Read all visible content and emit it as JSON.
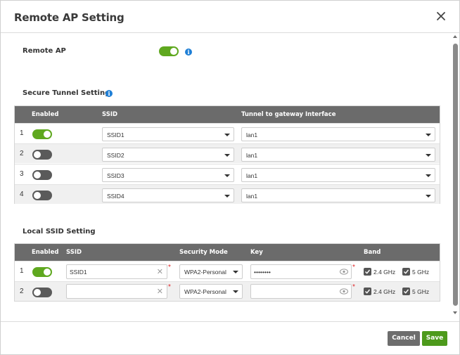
{
  "dialog": {
    "title": "Remote AP Setting"
  },
  "remote_ap": {
    "label": "Remote AP",
    "enabled": true
  },
  "secure_tunnel": {
    "title": "Secure Tunnel Setting",
    "columns": [
      "Enabled",
      "SSID",
      "Tunnel to gateway Interface"
    ],
    "rows": [
      {
        "index": "1",
        "enabled": true,
        "ssid": "SSID1",
        "interface": "lan1"
      },
      {
        "index": "2",
        "enabled": false,
        "ssid": "SSID2",
        "interface": "lan1"
      },
      {
        "index": "3",
        "enabled": false,
        "ssid": "SSID3",
        "interface": "lan1"
      },
      {
        "index": "4",
        "enabled": false,
        "ssid": "SSID4",
        "interface": "lan1"
      }
    ]
  },
  "local_ssid": {
    "title": "Local SSID Setting",
    "columns": [
      "Enabled",
      "SSID",
      "Security Mode",
      "Key",
      "Band"
    ],
    "rows": [
      {
        "index": "1",
        "enabled": true,
        "ssid": "SSID1",
        "security": "WPA2-Personal",
        "key": "••••••••",
        "band_24": "2.4 GHz",
        "band_5": "5 GHz"
      },
      {
        "index": "2",
        "enabled": false,
        "ssid": "",
        "security": "WPA2-Personal",
        "key": "",
        "band_24": "2.4 GHz",
        "band_5": "5 GHz"
      }
    ]
  },
  "footer": {
    "cancel_label": "Cancel",
    "save_label": "Save"
  },
  "colors": {
    "toggle_on": "#5fa81f",
    "toggle_off": "#5a5a5a",
    "header": "#6b6b6b",
    "save": "#4d9a1c",
    "cancel": "#6d6d6d",
    "info": "#1f7fd6",
    "required": "#e0292b"
  },
  "icons": {
    "close": "close-icon",
    "info": "info-icon",
    "caret": "chevron-down-icon",
    "clear": "clear-icon",
    "eye": "eye-icon",
    "check": "checkmark-icon"
  }
}
